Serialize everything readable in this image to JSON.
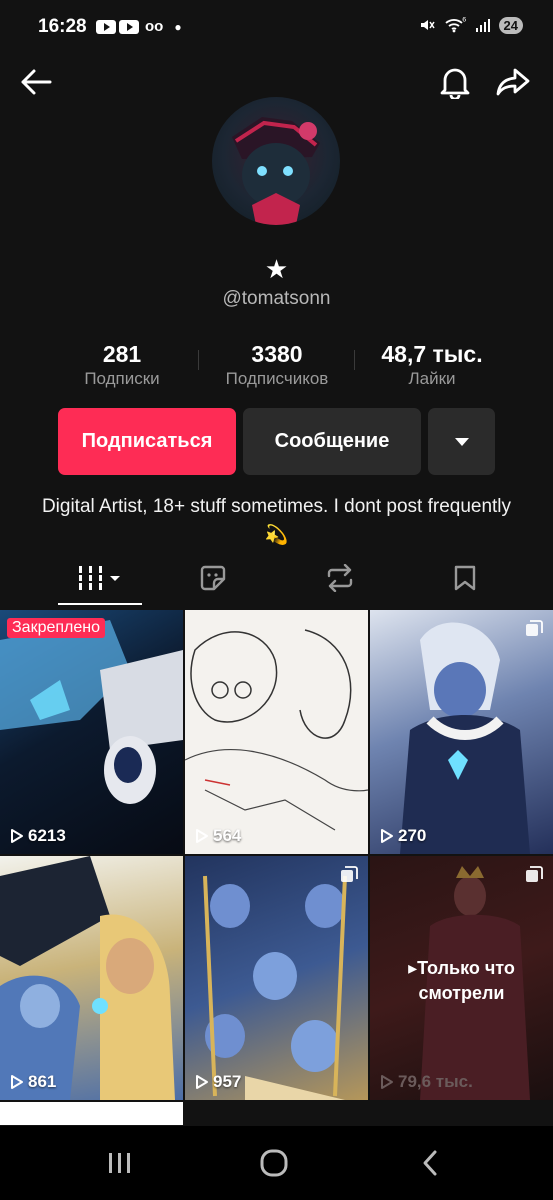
{
  "status_bar": {
    "time": "16:28",
    "battery": "24",
    "signal_label": "⁶",
    "icons": [
      "youtube-icon",
      "youtube-icon",
      "voicemail-icon",
      "dot-icon",
      "mute-icon",
      "wifi-icon",
      "signal-icon",
      "battery-icon"
    ]
  },
  "profile": {
    "display_name": "★",
    "username": "@tomatsonn",
    "bio": "Digital Artist, 18+ stuff sometimes. I dont post frequently 💫"
  },
  "stats": [
    {
      "value": "281",
      "label": "Подписки"
    },
    {
      "value": "3380",
      "label": "Подписчиков"
    },
    {
      "value": "48,7 тыс.",
      "label": "Лайки"
    }
  ],
  "actions": {
    "follow_label": "Подписаться",
    "message_label": "Сообщение"
  },
  "colors": {
    "background": "#121212",
    "accent": "#fe2c55",
    "button_secondary": "#2b2b2b"
  },
  "tabs": [
    "videos-grid-icon",
    "stickers-icon",
    "reposts-icon",
    "saved-icon"
  ],
  "videos": [
    {
      "views": "6213",
      "pinned": "Закреплено"
    },
    {
      "views": "564"
    },
    {
      "views": "270",
      "multi": true
    },
    {
      "views": "861"
    },
    {
      "views": "957",
      "multi": true
    },
    {
      "views": "79,6 тыс.",
      "multi": true,
      "overlay": "Только что смотрели"
    }
  ]
}
